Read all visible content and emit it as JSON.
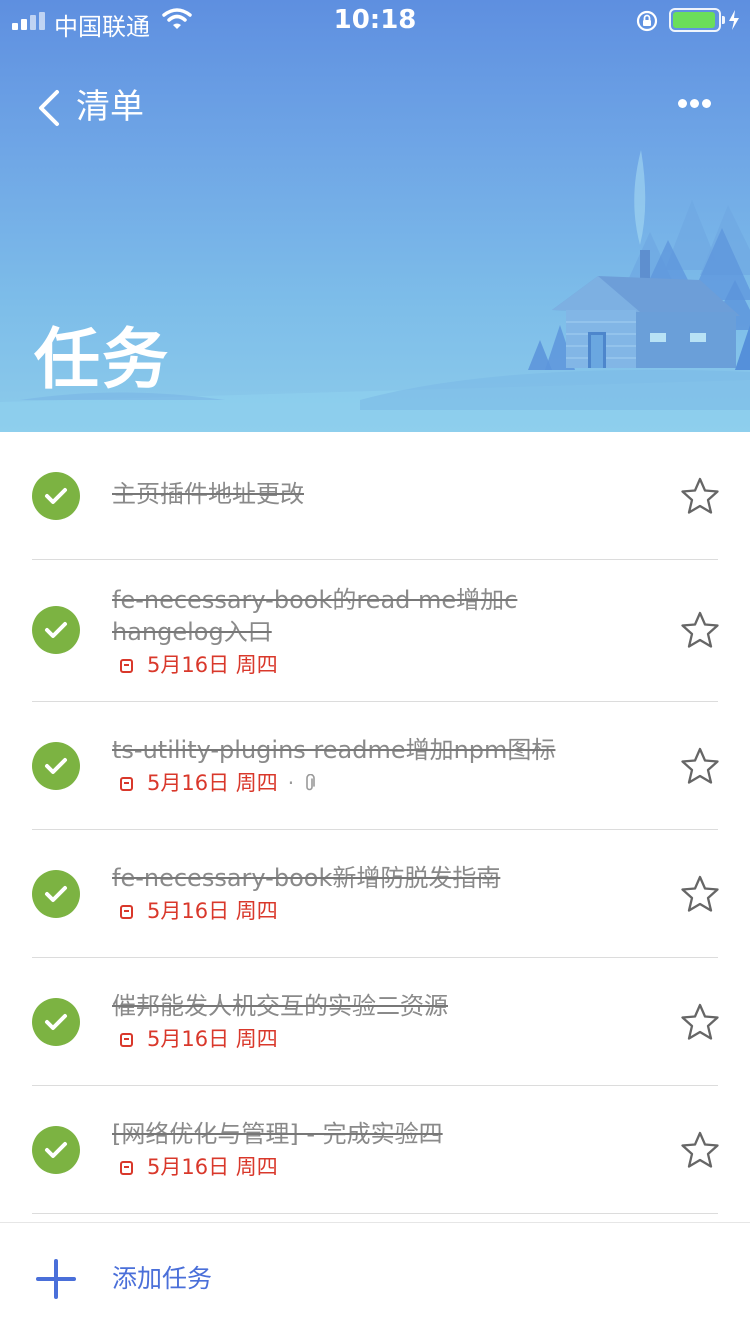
{
  "status_bar": {
    "carrier": "中国联通",
    "time": "10:18",
    "battery_level": 0.95,
    "icons": [
      "signal-icon",
      "wifi-icon",
      "orientation-lock-icon",
      "battery-icon",
      "charging-bolt-icon"
    ]
  },
  "nav": {
    "back_label": "清单",
    "back_icon": "chevron-left-icon",
    "more_icon": "more-dots-icon"
  },
  "page": {
    "title": "任务"
  },
  "colors": {
    "header_top": "#5e8fe0",
    "header_bottom": "#8ccbeb",
    "check_green": "#7cb342",
    "due_red": "#d9382b",
    "accent_blue": "#4a6fd9",
    "completed_text": "#8a8a8a"
  },
  "tasks": [
    {
      "title": "主页插件地址更改",
      "due": "",
      "completed": true,
      "starred": false,
      "has_attachment": false
    },
    {
      "title": "fe-necessary-book的read me增加changelog入口",
      "due": "5月16日 周四",
      "completed": true,
      "starred": false,
      "has_attachment": false
    },
    {
      "title": "ts-utility-plugins readme增加npm图标",
      "due": "5月16日 周四",
      "completed": true,
      "starred": false,
      "has_attachment": true
    },
    {
      "title": "fe-necessary-book新增防脱发指南",
      "due": "5月16日 周四",
      "completed": true,
      "starred": false,
      "has_attachment": false
    },
    {
      "title": "催邦能发人机交互的实验二资源",
      "due": "5月16日 周四",
      "completed": true,
      "starred": false,
      "has_attachment": false
    },
    {
      "title": "[网络优化与管理] - 完成实验四",
      "due": "5月16日 周四",
      "completed": true,
      "starred": false,
      "has_attachment": false
    }
  ],
  "add_task": {
    "label": "添加任务",
    "icon": "plus-icon"
  }
}
